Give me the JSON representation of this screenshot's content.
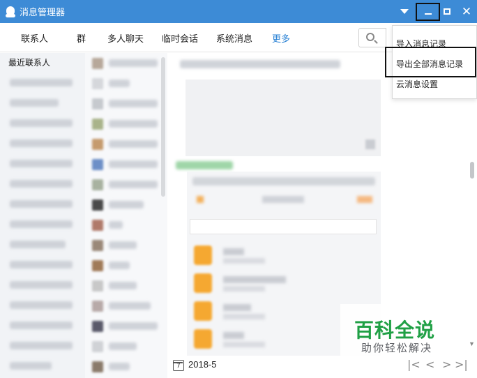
{
  "window": {
    "title": "消息管理器",
    "accent": "#3d8bd6"
  },
  "tabs": [
    {
      "label": "联系人"
    },
    {
      "label": "群"
    },
    {
      "label": "多人聊天"
    },
    {
      "label": "临时会话"
    },
    {
      "label": "系统消息"
    },
    {
      "label": "更多",
      "active": true
    }
  ],
  "left_panel": {
    "header": "最近联系人"
  },
  "dropdown_menu": {
    "items": [
      {
        "label": "导入消息记录"
      },
      {
        "label": "导出全部消息记录",
        "highlighted": true
      },
      {
        "label": "云消息设置"
      }
    ]
  },
  "bottom_bar": {
    "date": "2018-5",
    "calendar_number": "7"
  },
  "watermark": {
    "title": "百科全说",
    "subtitle": "助你轻松解决"
  }
}
